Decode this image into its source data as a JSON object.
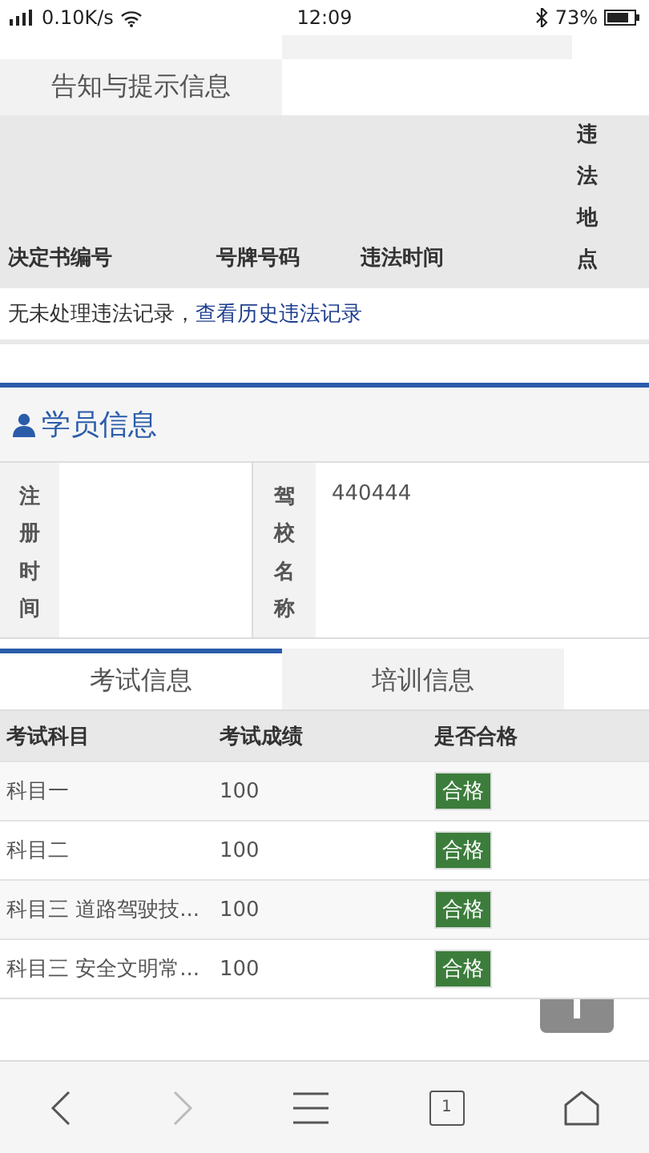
{
  "status_bar": {
    "network": "0.10K/s",
    "time": "12:09",
    "battery": "73%"
  },
  "notice_tab": {
    "label": "告知与提示信息",
    "selected": true
  },
  "violation_table": {
    "columns": [
      "决定书编号",
      "号牌号码",
      "违法时间",
      "违法地点"
    ],
    "empty_message": "无未处理违法记录，",
    "history_link": "查看历史违法记录"
  },
  "student_panel": {
    "title": "学员信息",
    "fields": [
      {
        "label": "注册时间"
      },
      {
        "label": "驾校名称",
        "value": "440444"
      }
    ]
  },
  "tabs": [
    {
      "label": "考试信息",
      "selected": true
    },
    {
      "label": "培训信息",
      "selected": false
    }
  ],
  "exam_table": {
    "columns": [
      "考试科目",
      "考试成绩",
      "是否合格"
    ],
    "rows": [
      {
        "subject": "科目一",
        "score": "100",
        "result": "合格",
        "passed": true
      },
      {
        "subject": "科目二",
        "score": "100",
        "result": "合格",
        "passed": true
      },
      {
        "subject": "科目三 道路驾驶技...",
        "score": "100",
        "result": "合格",
        "passed": true
      },
      {
        "subject": "科目三 安全文明常...",
        "score": "100",
        "result": "合格",
        "passed": true
      }
    ]
  },
  "browser_bar": {
    "tab_count": "1",
    "forward_disabled": true
  }
}
